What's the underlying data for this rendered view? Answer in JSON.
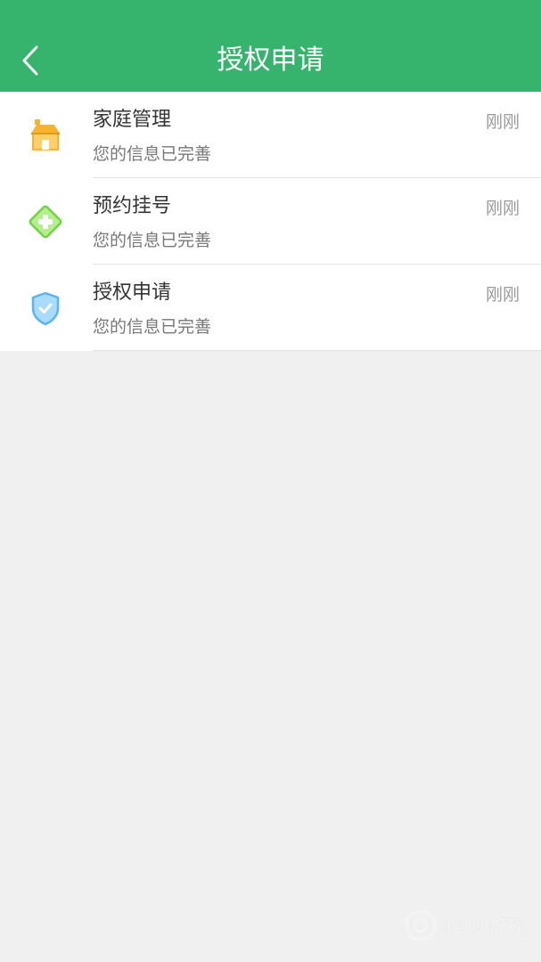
{
  "header": {
    "title": "授权申请",
    "back_icon": "chevron-left-icon",
    "background": "#36b46e"
  },
  "items": [
    {
      "label": "家庭管理",
      "subtitle": "您的信息已完善",
      "time": "刚刚",
      "icon": "house-icon",
      "color": "#f7b22e"
    },
    {
      "label": "预约挂号",
      "subtitle": "您的信息已完善",
      "time": "刚刚",
      "icon": "medical-cross-icon",
      "color": "#6fd343"
    },
    {
      "label": "授权申请",
      "subtitle": "您的信息已完善",
      "time": "刚刚",
      "icon": "shield-check-icon",
      "color": "#5ab4f0"
    }
  ],
  "watermark": {
    "text": "搜搜游戏"
  }
}
